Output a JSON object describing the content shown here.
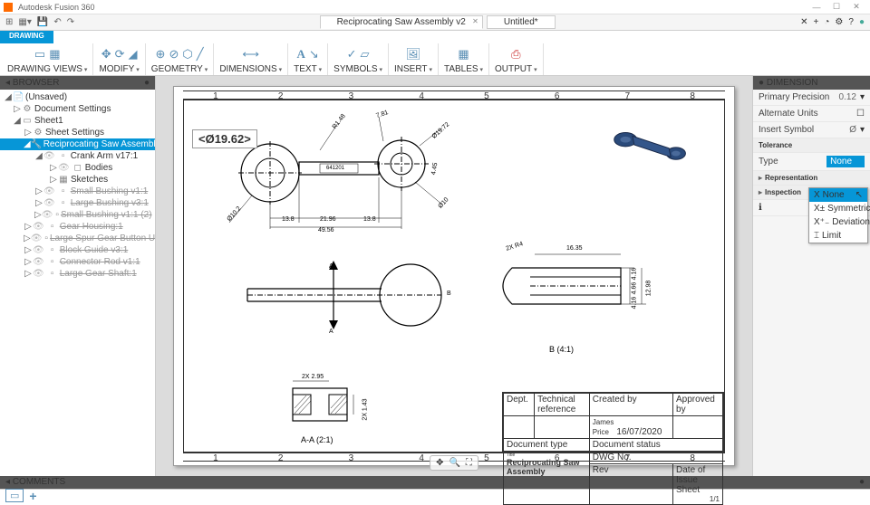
{
  "app": {
    "title": "Autodesk Fusion 360"
  },
  "tabs": {
    "doc1": "Reciprocating Saw Assembly v2",
    "doc2": "Untitled*"
  },
  "ribbon_tab": "DRAWING",
  "ribbon": {
    "g1": "DRAWING VIEWS",
    "g2": "MODIFY",
    "g3": "GEOMETRY",
    "g4": "DIMENSIONS",
    "g5": "TEXT",
    "g6": "SYMBOLS",
    "g7": "INSERT",
    "g8": "TABLES",
    "g9": "OUTPUT"
  },
  "browser": {
    "title": "BROWSER",
    "root": "(Unsaved)",
    "docSettings": "Document Settings",
    "sheet": "Sheet1",
    "sheetSettings": "Sheet Settings",
    "assembly": "Reciprocating Saw Assembly v2:1",
    "crankArm": "Crank Arm v17:1",
    "bodies": "Bodies",
    "sketches": "Sketches",
    "sb1": "Small Bushing v1:1",
    "lb1": "Large Bushing v3:1",
    "sb2": "Small Bushing v1:1 (2)",
    "gh": "Gear Housing:1",
    "lsg": "Large Spur Gear Button Up...",
    "bg": "Block Guide v3:1",
    "cr": "Connector Rod v1:1",
    "lgs": "Large Gear Shaft:1"
  },
  "dim_input": "<Ø19.62>",
  "views": {
    "aa": "A-A (2:1)",
    "b": "B (4:1)",
    "d1": "13.8",
    "d2": "21.96",
    "d3": "13.8",
    "d4": "49.56",
    "d5": "R1.48",
    "d6": "7.81",
    "d7": "Ø19.72",
    "d8": "4.45",
    "d9": "Ø10",
    "d10": "Ø10.2",
    "d11": "2X R4",
    "d12": "16.35",
    "d13": "4.16",
    "d14": "4.66",
    "d15": "4.16",
    "d16": "12.98",
    "d17": "2X 2.95",
    "d18": "2X 1.43",
    "ref": "641201",
    "secA": "A",
    "secB": "B"
  },
  "title_block": {
    "created_by_lbl": "Created by",
    "created_by": "James Price",
    "date": "16/07/2020",
    "approved_lbl": "Approved by",
    "doctype_lbl": "Document type",
    "docstatus_lbl": "Document status",
    "title_lbl": "Title",
    "dwg_lbl": "DWG No.",
    "title": "Reciprocating Saw Assembly",
    "rev_lbl": "Rev",
    "doi_lbl": "Date of Issue",
    "sheet_lbl": "Sheet",
    "sheet": "1/1",
    "dept_lbl": "Dept.",
    "techref_lbl": "Technical reference"
  },
  "panel": {
    "title": "DIMENSION",
    "primary": "Primary Precision",
    "primary_val": "0.12",
    "alt": "Alternate Units",
    "insert": "Insert Symbol",
    "insert_val": "Ø",
    "tolerance": "Tolerance",
    "type": "Type",
    "type_val": "None",
    "representation": "Representation",
    "inspection": "Inspection",
    "opts": {
      "none": "None",
      "sym": "Symmetrical",
      "dev": "Deviation",
      "lim": "Limit"
    }
  },
  "comments": "COMMENTS",
  "ruler": {
    "n1": "1",
    "n2": "2",
    "n3": "3",
    "n4": "4",
    "n5": "5",
    "n6": "6",
    "n7": "7",
    "n8": "8"
  }
}
